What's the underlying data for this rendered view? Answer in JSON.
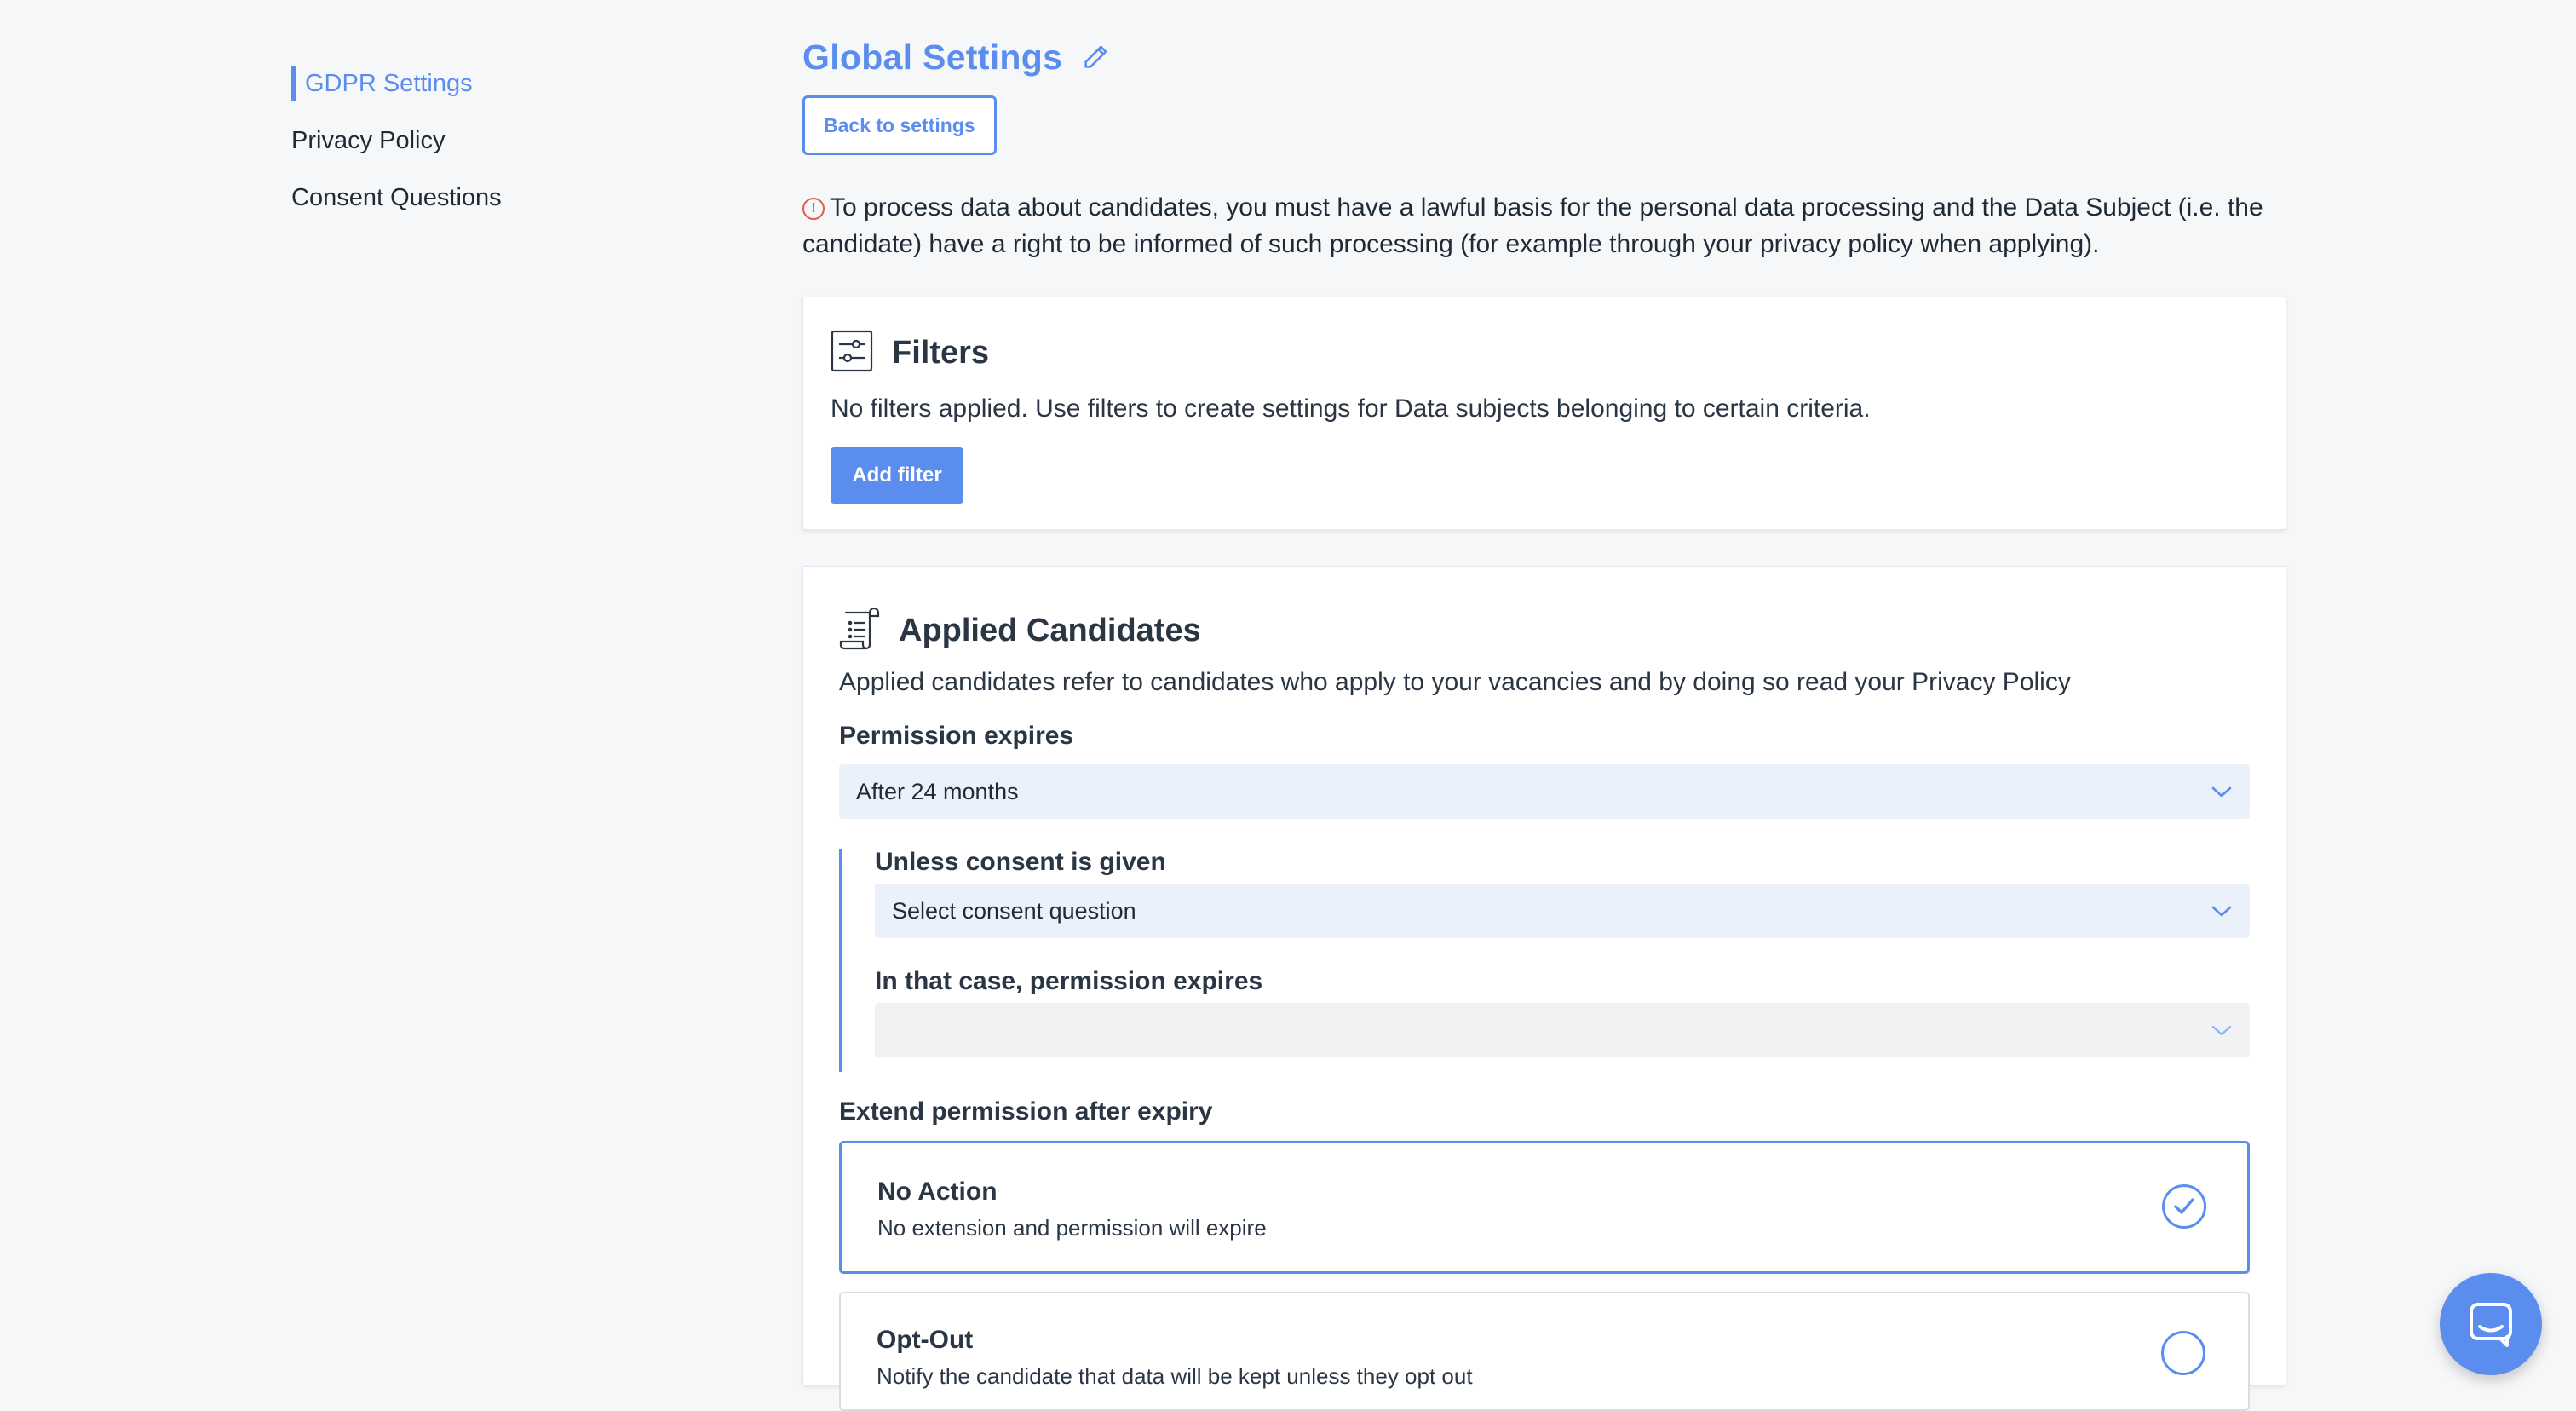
{
  "sidebar": {
    "items": [
      {
        "label": "GDPR Settings",
        "active": true
      },
      {
        "label": "Privacy Policy",
        "active": false
      },
      {
        "label": "Consent Questions",
        "active": false
      }
    ]
  },
  "header": {
    "title": "Global Settings",
    "back_label": "Back to settings"
  },
  "notice": {
    "text": "To process data about candidates, you must have a lawful basis for the personal data processing and the Data Subject (i.e. the candidate) have a right to be informed of such processing (for example through your privacy policy when applying)."
  },
  "filters": {
    "title": "Filters",
    "description": "No filters applied. Use filters to create settings for Data subjects belonging to certain criteria.",
    "add_label": "Add filter"
  },
  "applied": {
    "title": "Applied Candidates",
    "description": "Applied candidates refer to candidates who apply to your vacancies and by doing so read your Privacy Policy",
    "permission_label": "Permission expires",
    "permission_value": "After 24 months",
    "consent_label": "Unless consent is given",
    "consent_placeholder": "Select consent question",
    "case_label": "In that case, permission expires",
    "case_value": "",
    "extend_label": "Extend permission after expiry",
    "options": [
      {
        "title": "No Action",
        "description": "No extension and permission will expire",
        "selected": true
      },
      {
        "title": "Opt-Out",
        "description": "Notify the candidate that data will be kept unless they opt out",
        "selected": false
      }
    ]
  },
  "colors": {
    "accent": "#5b8def",
    "warning": "#e25b4b",
    "background": "#f5f7f9"
  },
  "icons": [
    "pencil-icon",
    "alert-circle-icon",
    "filter-sliders-icon",
    "document-list-icon",
    "chevron-down-icon",
    "check-icon",
    "chat-icon"
  ]
}
